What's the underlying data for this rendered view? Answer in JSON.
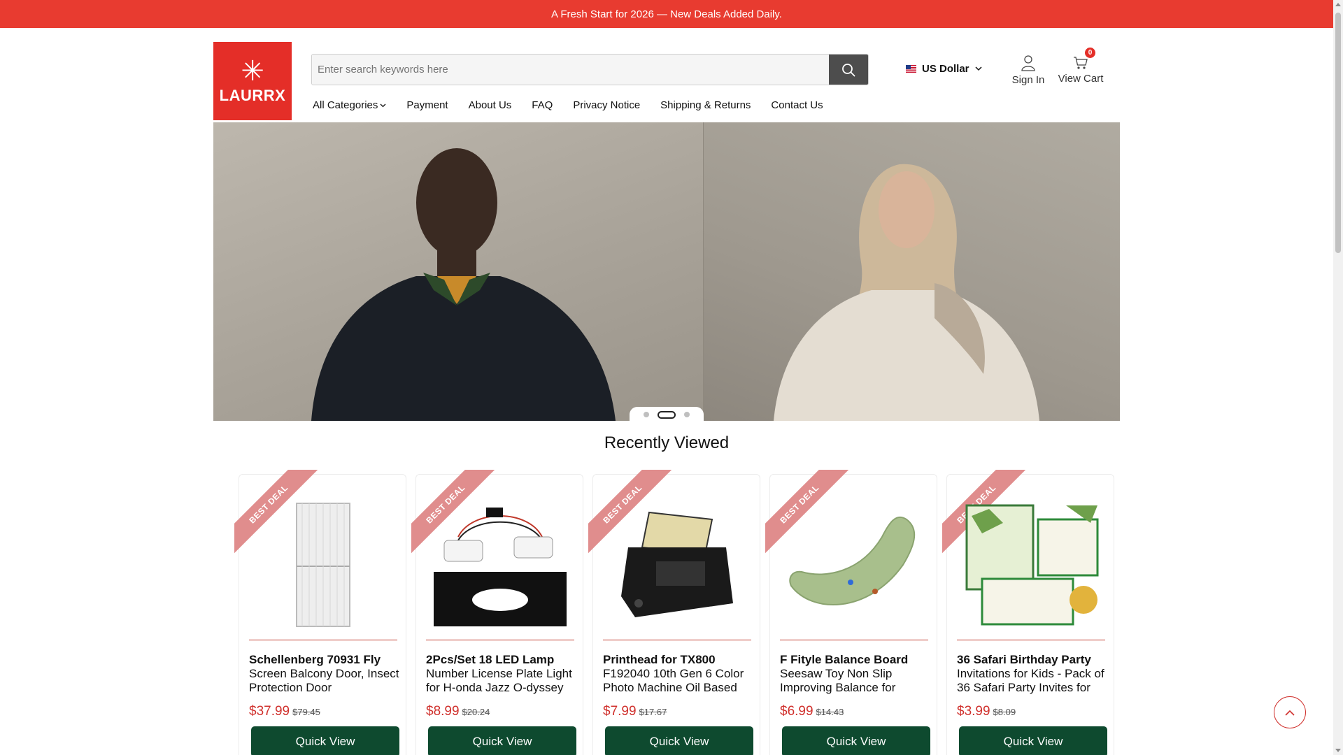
{
  "announcement": "A Fresh Start for 2026 — New Deals Added Daily.",
  "brand": {
    "name": "LAURRX",
    "color": "#e42e28"
  },
  "search": {
    "placeholder": "Enter search keywords here",
    "icon": "search-icon"
  },
  "currency": {
    "label": "US Dollar",
    "flag": "us-flag-icon"
  },
  "account": {
    "sign_in": "Sign In",
    "view_cart": "View Cart",
    "cart_count": "0"
  },
  "nav": {
    "all_categories": "All Categories",
    "items": [
      "Payment",
      "About Us",
      "FAQ",
      "Privacy Notice",
      "Shipping & Returns",
      "Contact Us"
    ]
  },
  "hero": {
    "slides": 3,
    "active_slide": 2
  },
  "section_title": "Recently Viewed",
  "badge_label": "BEST DEAL",
  "quick_view_label": "Quick View",
  "colors": {
    "topbar": "#e83b30",
    "button": "#0e4a2f",
    "price": "#d0312d"
  },
  "products": [
    {
      "name_bold": "Schellenberg 70931 Fly",
      "name_rest": "Screen Balcony Door, Insect Protection Door",
      "price": "$37.99",
      "old_price": "$79.45"
    },
    {
      "name_bold": "2Pcs/Set 18 LED Lamp",
      "name_rest": "Number License Plate Light for H-onda Jazz O-dyssey",
      "price": "$8.99",
      "old_price": "$20.24"
    },
    {
      "name_bold": "Printhead for TX800",
      "name_rest": "F192040 10th Gen 6 Color Photo Machine Oil Based",
      "price": "$7.99",
      "old_price": "$17.67"
    },
    {
      "name_bold": "F Fityle Balance Board",
      "name_rest": "Seesaw Toy Non Slip Improving Balance for",
      "price": "$6.99",
      "old_price": "$14.43"
    },
    {
      "name_bold": "36 Safari Birthday Party",
      "name_rest": "Invitations for Kids - Pack of 36 Safari Party Invites for",
      "price": "$3.99",
      "old_price": "$8.09"
    }
  ]
}
